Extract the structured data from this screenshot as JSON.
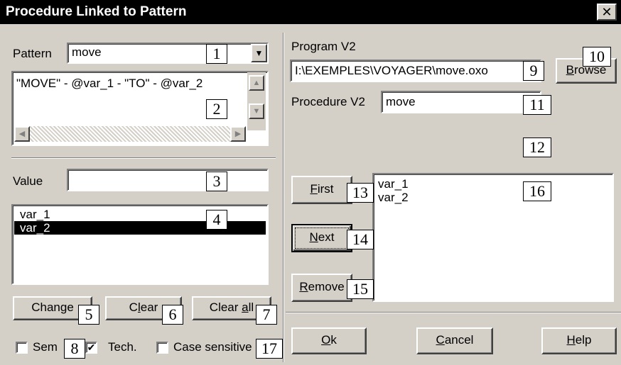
{
  "window": {
    "title": "Procedure Linked to Pattern",
    "close_glyph": "✕"
  },
  "left": {
    "pattern_label": "Pattern",
    "pattern_value": "move",
    "pattern_text": "\"MOVE\" - @var_1 - \"TO\" - @var_2",
    "value_label": "Value",
    "value_input": "",
    "variables": [
      {
        "label": "var_1",
        "selected": false
      },
      {
        "label": "var_2",
        "selected": true
      }
    ],
    "change_button": "Change",
    "clear_button": {
      "pre": "C",
      "key": "l",
      "post": "ear"
    },
    "clear_all_button": {
      "pre": "Clear ",
      "key": "a",
      "post": "ll"
    },
    "sem_checkbox": {
      "label": "Sem",
      "checked": false
    },
    "tech_checkbox": {
      "label": "Tech.",
      "checked": true
    },
    "case_checkbox": {
      "label": "Case sensitive",
      "checked": false
    }
  },
  "right": {
    "program_label": "Program V2",
    "program_path": "I:\\EXEMPLES\\VOYAGER\\move.oxo",
    "browse_button": {
      "pre": "",
      "key": "B",
      "post": "rowse"
    },
    "procedure_label": "Procedure V2",
    "procedure_value": "move",
    "first_button": {
      "pre": "",
      "key": "F",
      "post": "irst"
    },
    "next_button": {
      "pre": "",
      "key": "N",
      "post": "ext"
    },
    "remove_button": {
      "pre": "",
      "key": "R",
      "post": "emove"
    },
    "params": [
      "var_1",
      "var_2"
    ]
  },
  "footer": {
    "ok_button": {
      "pre": "",
      "key": "O",
      "post": "k"
    },
    "cancel_button": {
      "pre": "",
      "key": "C",
      "post": "ancel"
    },
    "help_button": {
      "pre": "",
      "key": "H",
      "post": "elp"
    }
  },
  "callouts": [
    "1",
    "2",
    "3",
    "4",
    "5",
    "6",
    "7",
    "8",
    "9",
    "10",
    "11",
    "12",
    "13",
    "14",
    "15",
    "16",
    "17"
  ],
  "icons": {
    "dropdown": "dropdown-arrow-icon",
    "scroll_up": "scroll-up-arrow-icon",
    "scroll_down": "scroll-down-arrow-icon",
    "scroll_left": "scroll-left-arrow-icon",
    "scroll_right": "scroll-right-arrow-icon",
    "check": "checkmark-icon"
  },
  "colors": {
    "face": "#d4d0c8",
    "titlebar": "#000000",
    "selection": "#000000"
  }
}
